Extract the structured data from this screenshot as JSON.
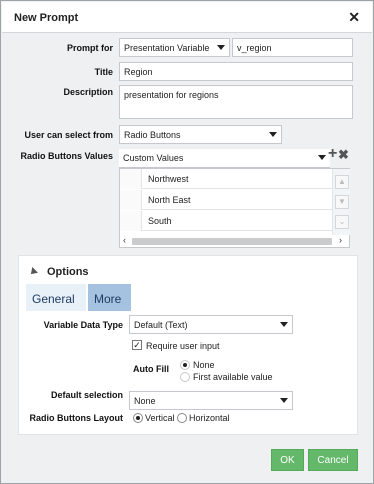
{
  "dialog": {
    "title": "New Prompt",
    "close_glyph": "✕"
  },
  "form": {
    "prompt_for_label": "Prompt for",
    "prompt_for_value": "Presentation Variable",
    "variable_name": "v_region",
    "title_label": "Title",
    "title_value": "Region",
    "description_label": "Description",
    "description_value": "presentation for regions",
    "user_select_label": "User can select from",
    "user_select_value": "Radio Buttons",
    "rb_values_label": "Radio Buttons Values",
    "rb_values_source": "Custom Values",
    "values": [
      "Northwest",
      "North East",
      "South"
    ]
  },
  "options": {
    "header": "Options",
    "tabs": [
      {
        "label": "General"
      },
      {
        "label": "More"
      }
    ],
    "variable_data_type_label": "Variable Data Type",
    "variable_data_type_value": "Default (Text)",
    "require_input_label": "Require user input",
    "require_input_checked": true,
    "auto_fill_label": "Auto Fill",
    "auto_fill_options": [
      "None",
      "First available value"
    ],
    "default_selection_label": "Default selection",
    "default_selection_value": "None",
    "layout_label": "Radio Buttons Layout",
    "layout_options": [
      "Vertical",
      "Horizontal"
    ]
  },
  "footer": {
    "ok_label": "OK",
    "cancel_label": "Cancel"
  },
  "colors": {
    "primary_button": "#64b86a",
    "selected_tab": "#a5c2e0",
    "tab_text": "#1f3b63"
  }
}
